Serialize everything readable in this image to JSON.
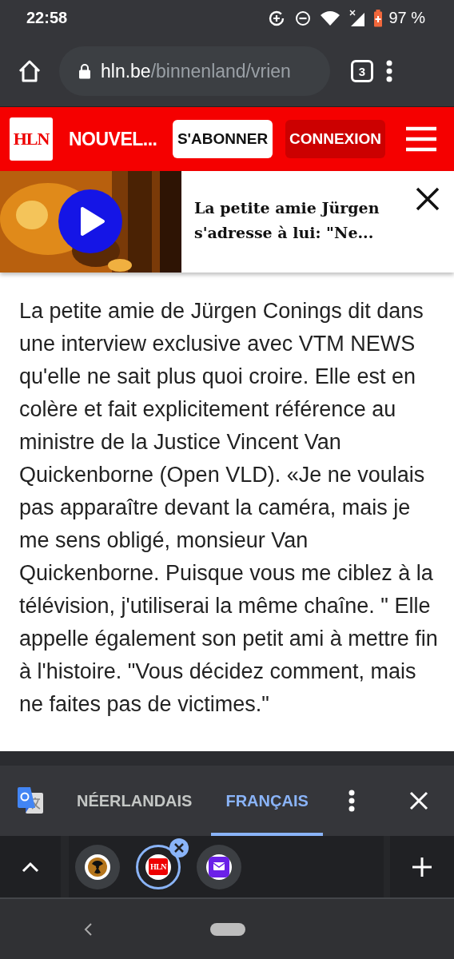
{
  "status_bar": {
    "time": "22:58",
    "battery": "97 %"
  },
  "toolbar": {
    "url_host": "hln.be",
    "url_path": "/binnenland/vrien",
    "tab_count": "3"
  },
  "site_header": {
    "logo": "HLN",
    "section": "NOUVEL...",
    "subscribe": "S'ABONNER",
    "login": "CONNEXION"
  },
  "teaser": {
    "title": "La petite amie Jürgen s'adresse à lui: \"Ne..."
  },
  "article": {
    "text": "La petite amie de Jürgen Conings dit dans une interview exclusive avec VTM NEWS qu'elle ne sait plus quoi croire. Elle est en colère et fait explicitement référence au ministre de la Justice Vincent Van Quickenborne (Open VLD). «Je ne voulais pas apparaître devant la caméra, mais je me sens obligé, monsieur Van Quickenborne. Puisque vous me ciblez à la télévision, j'utiliserai la même chaîne. \" Elle appelle également son petit ami à mettre fin à l'histoire. \"Vous décidez comment, mais ne faites pas de victimes.\""
  },
  "translate_bar": {
    "tabs": [
      {
        "label": "NÉERLANDAIS",
        "selected": false
      },
      {
        "label": "FRANÇAIS",
        "selected": true
      }
    ]
  },
  "tab_strip": {
    "tabs": [
      {
        "kind": "radiation",
        "selected": false
      },
      {
        "kind": "hln",
        "logo": "HLN",
        "selected": true
      },
      {
        "kind": "mail",
        "selected": false
      }
    ]
  }
}
